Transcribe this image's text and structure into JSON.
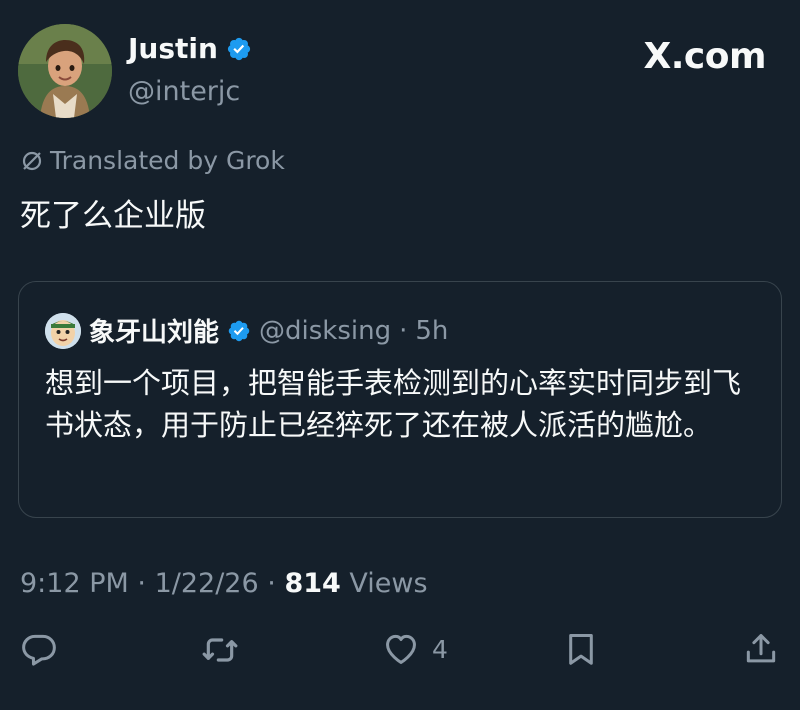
{
  "author": {
    "display_name": "Justin",
    "handle": "@interjc",
    "verified": true,
    "avatar": "cartoon-boy-avatar"
  },
  "site": "X.com",
  "translation_note": "Translated by Grok",
  "tweet_text": "死了么企业版",
  "quote": {
    "display_name": "象牙山刘能",
    "handle": "@disksing",
    "separator": "·",
    "time_ago": "5h",
    "verified": true,
    "text": "想到一个项目，把智能手表检测到的心率实时同步到飞书状态，用于防止已经猝死了还在被人派活的尴尬。"
  },
  "meta": {
    "time": "9:12 PM",
    "sep1": "·",
    "date": "1/22/26",
    "sep2": "·",
    "views_count": "814",
    "views_label": "Views"
  },
  "actions": {
    "reply_icon": "reply-icon",
    "retweet_icon": "retweet-icon",
    "like_icon": "heart-icon",
    "like_count": "4",
    "bookmark_icon": "bookmark-icon",
    "share_icon": "share-icon"
  },
  "colors": {
    "background": "#15202b",
    "text": "#f7f9f9",
    "secondary": "#8b98a5",
    "verified": "#1d9bf0",
    "border": "#38444d"
  }
}
